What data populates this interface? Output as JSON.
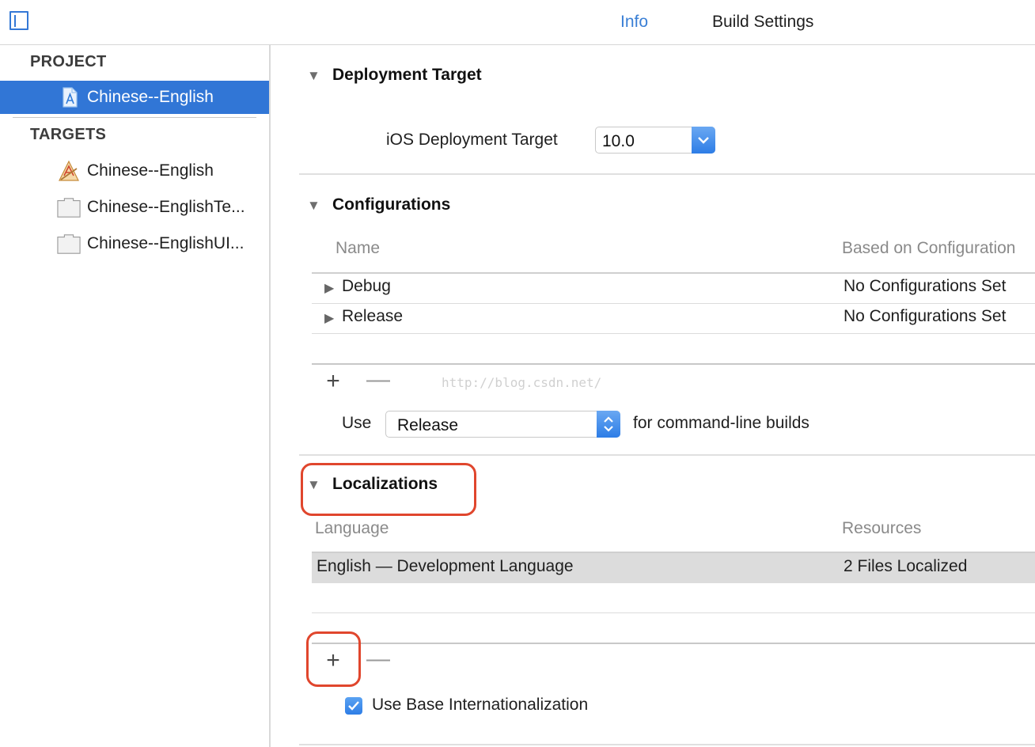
{
  "toolbar": {
    "tabs": [
      {
        "label": "Info",
        "selected": true
      },
      {
        "label": "Build Settings",
        "selected": false
      }
    ]
  },
  "sidebar": {
    "project_header": "PROJECT",
    "project_item": {
      "label": "Chinese--English",
      "icon": "project-file-icon"
    },
    "targets_header": "TARGETS",
    "targets": [
      {
        "label": "Chinese--English",
        "icon": "app-target-icon"
      },
      {
        "label": "Chinese--EnglishTe...",
        "icon": "test-bundle-icon"
      },
      {
        "label": "Chinese--EnglishUI...",
        "icon": "test-bundle-icon"
      }
    ]
  },
  "deployment": {
    "title": "Deployment Target",
    "ios_label": "iOS Deployment Target",
    "ios_value": "10.0"
  },
  "configurations": {
    "title": "Configurations",
    "col_name": "Name",
    "col_based_on": "Based on Configuration",
    "rows": [
      {
        "name": "Debug",
        "based_on": "No Configurations Set"
      },
      {
        "name": "Release",
        "based_on": "No Configurations Set"
      }
    ],
    "add": "+",
    "remove": "—",
    "use_label": "Use",
    "use_value": "Release",
    "use_suffix": "for command-line builds"
  },
  "localizations": {
    "title": "Localizations",
    "col_language": "Language",
    "col_resources": "Resources",
    "rows": [
      {
        "language": "English — Development Language",
        "resources": "2 Files Localized"
      }
    ],
    "add": "+",
    "remove": "—",
    "use_base_label": "Use Base Internationalization",
    "use_base_checked": true
  },
  "watermark": "http://blog.csdn.net/",
  "colors": {
    "accent": "#3176d6",
    "highlight_box": "#e0462d"
  }
}
